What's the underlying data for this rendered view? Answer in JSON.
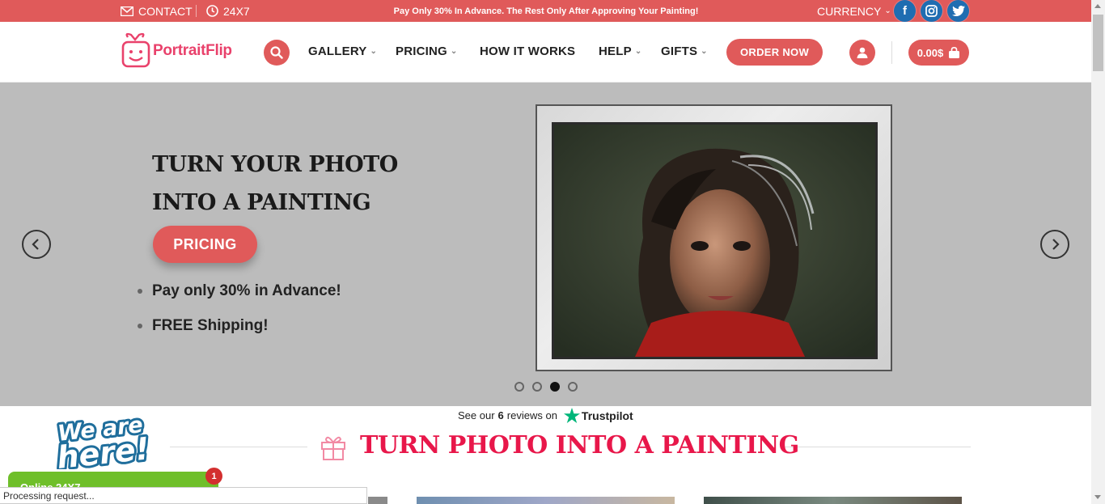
{
  "topbar": {
    "contact_label": "CONTACT",
    "hours_label": "24X7",
    "promo": "Pay Only 30% In Advance. The Rest Only After Approving Your Painting!",
    "currency_label": "CURRENCY",
    "social": [
      {
        "name": "facebook",
        "glyph": "f",
        "color": "#1f6db1"
      },
      {
        "name": "instagram",
        "glyph": "◎",
        "color": "#1f6db1"
      },
      {
        "name": "twitter",
        "glyph": "🐦",
        "color": "#1f6db1"
      }
    ]
  },
  "header": {
    "logo_text": "PortraitFlip",
    "nav": [
      {
        "label": "GALLERY",
        "dropdown": true
      },
      {
        "label": "PRICING",
        "dropdown": true
      },
      {
        "label": "HOW IT WORKS",
        "dropdown": false
      },
      {
        "label": "HELP",
        "dropdown": true
      },
      {
        "label": "GIFTS",
        "dropdown": true
      }
    ],
    "order_button": "ORDER NOW",
    "cart_total": "0.00$"
  },
  "hero": {
    "title_line1": "TURN YOUR PHOTO",
    "title_line2": "INTO A PAINTING",
    "pricing_button": "PRICING",
    "bullets": [
      "Pay only 30% in Advance!",
      "FREE Shipping!"
    ],
    "slides_total": 4,
    "active_slide": 3
  },
  "reviews": {
    "prefix": "See our",
    "count": "6",
    "suffix": "reviews on",
    "platform": "Trustpilot"
  },
  "section": {
    "title": "TURN PHOTO INTO A PAINTING"
  },
  "chat": {
    "label": "Online 24X7",
    "badge_count": "1"
  },
  "status": {
    "text": "Processing request..."
  },
  "colors": {
    "accent": "#e05a5a",
    "section_title": "#e8174a",
    "trustpilot": "#00b67a",
    "chat": "#6fbf2a"
  }
}
